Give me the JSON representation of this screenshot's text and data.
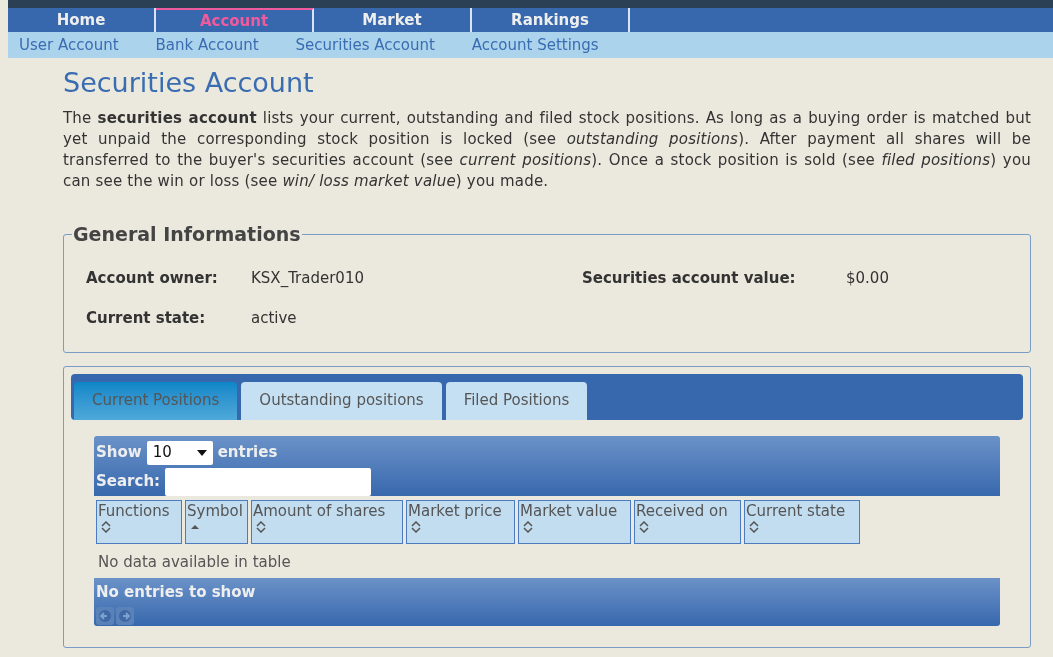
{
  "main_nav": [
    {
      "label": "Home",
      "selected": false
    },
    {
      "label": "Account",
      "selected": true
    },
    {
      "label": "Market",
      "selected": false
    },
    {
      "label": "Rankings",
      "selected": false
    }
  ],
  "sub_nav": [
    "User Account",
    "Bank Account",
    "Securities Account",
    "Account Settings"
  ],
  "page_title": "Securities Account",
  "intro": "The **securities account** lists your current, outstanding and filed stock positions. As long as a buying order is matched but yet unpaid the corresponding stock position is locked (see *outstanding positions*). After payment all shares will be transferred to the buyer's securities account (see *current positions*). Once a stock position is sold (see *filed positions*) you can see the win or loss (see *win/ loss market value*) you made.",
  "general": {
    "legend": "General Informations",
    "fields": [
      {
        "label": "Account owner:",
        "value": "KSX_Trader010"
      },
      {
        "label": "Securities account value:",
        "value": "$0.00"
      },
      {
        "label": "Current state:",
        "value": "active"
      }
    ]
  },
  "tabs": [
    {
      "label": "Current Positions",
      "selected": true
    },
    {
      "label": "Outstanding positions",
      "selected": false
    },
    {
      "label": "Filed Positions",
      "selected": false
    }
  ],
  "table": {
    "show_label": "Show",
    "page_size": "10",
    "entries_label": "entries",
    "search_label": "Search:",
    "columns": [
      {
        "label": "Functions",
        "kind": "sortable"
      },
      {
        "label": "Symbol",
        "kind": "ascending"
      },
      {
        "label": "Amount of shares",
        "kind": "sortable"
      },
      {
        "label": "Market price",
        "kind": "sortable"
      },
      {
        "label": "Market value",
        "kind": "sortable"
      },
      {
        "label": "Received on",
        "kind": "sortable"
      },
      {
        "label": "Current state",
        "kind": "sortable"
      }
    ],
    "empty_message": "No data available in table",
    "info": "No entries to show"
  }
}
